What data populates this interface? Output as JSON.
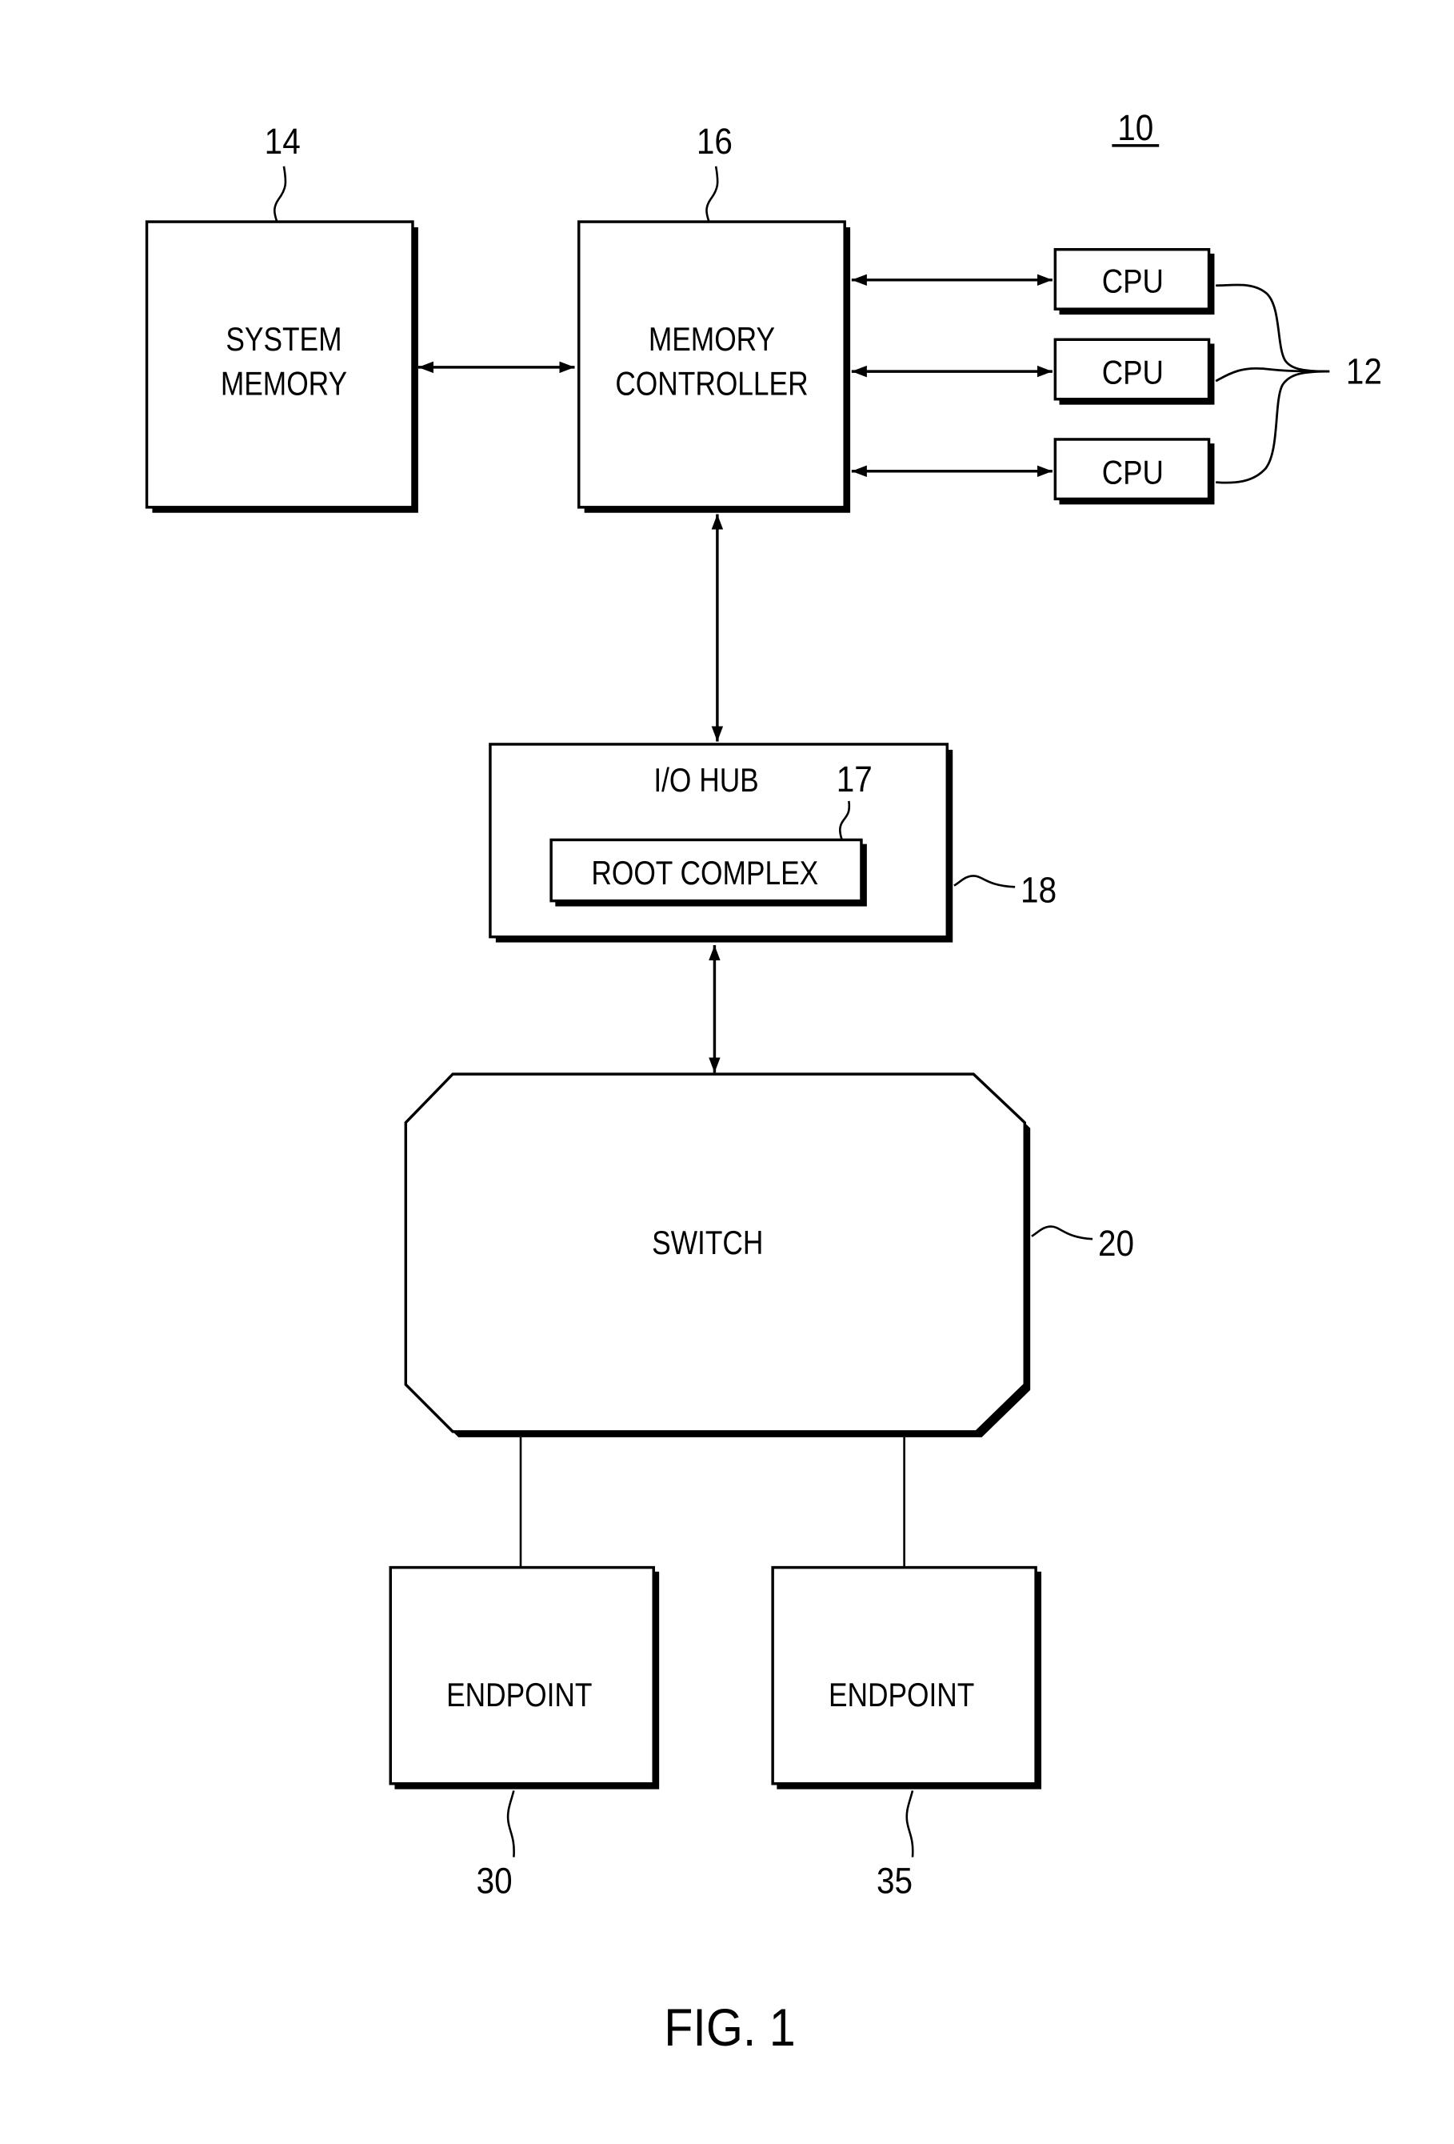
{
  "figure": {
    "title": "FIG. 1",
    "system_ref": "10",
    "colors": {
      "line": "#000000",
      "background": "#ffffff"
    }
  },
  "nodes": {
    "system_memory": {
      "label_lines": [
        "SYSTEM",
        "MEMORY"
      ],
      "ref": "14"
    },
    "memory_controller": {
      "label_lines": [
        "MEMORY",
        "CONTROLLER"
      ],
      "ref": "16"
    },
    "cpus": {
      "labels": [
        "CPU",
        "CPU",
        "CPU"
      ],
      "ref": "12"
    },
    "io_hub": {
      "label": "I/O HUB",
      "ref": "18"
    },
    "root_complex": {
      "label": "ROOT COMPLEX",
      "ref": "17"
    },
    "switch": {
      "label": "SWITCH",
      "ref": "20"
    },
    "endpoint_a": {
      "label": "ENDPOINT",
      "ref": "30"
    },
    "endpoint_b": {
      "label": "ENDPOINT",
      "ref": "35"
    }
  },
  "connections": [
    {
      "from": "system_memory",
      "to": "memory_controller",
      "type": "bidirectional"
    },
    {
      "from": "memory_controller",
      "to": "cpu_1",
      "type": "bidirectional"
    },
    {
      "from": "memory_controller",
      "to": "cpu_2",
      "type": "bidirectional"
    },
    {
      "from": "memory_controller",
      "to": "cpu_3",
      "type": "bidirectional"
    },
    {
      "from": "memory_controller",
      "to": "io_hub",
      "type": "bidirectional"
    },
    {
      "from": "io_hub",
      "to": "switch",
      "type": "bidirectional"
    },
    {
      "from": "switch",
      "to": "endpoint_a",
      "type": "line"
    },
    {
      "from": "switch",
      "to": "endpoint_b",
      "type": "line"
    }
  ]
}
